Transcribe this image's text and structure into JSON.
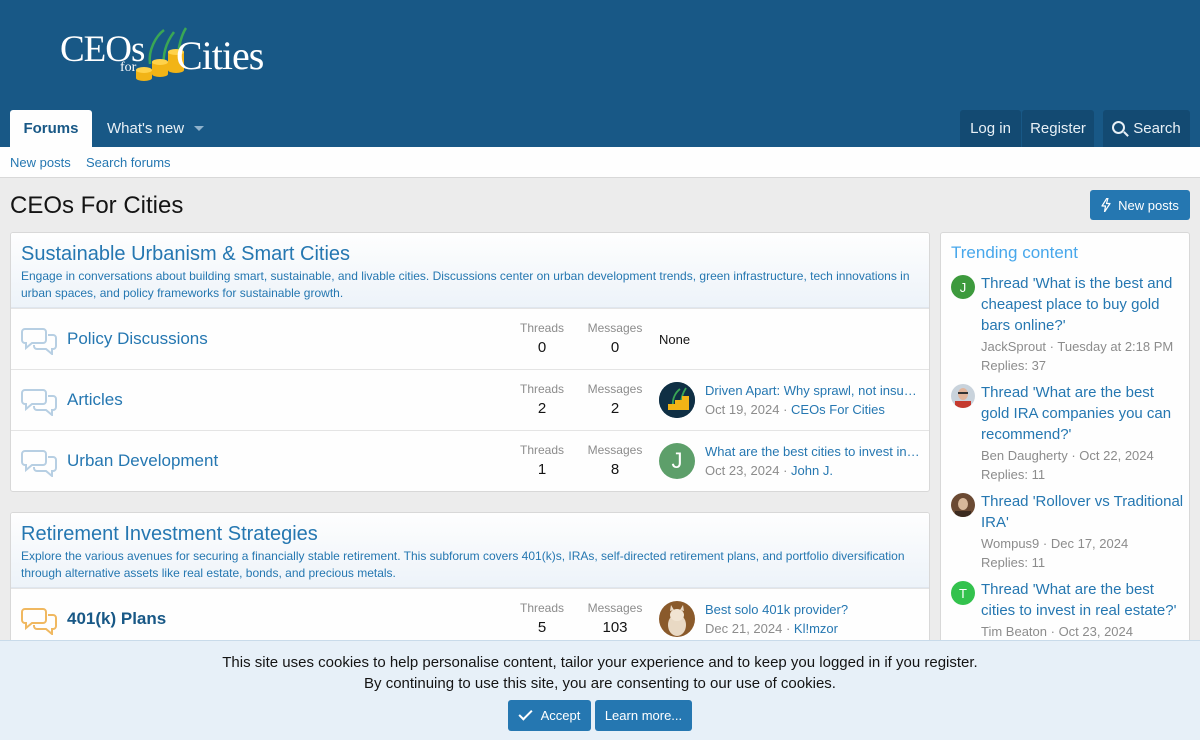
{
  "header": {
    "logo": {
      "line1": "CEOs",
      "line2": "for",
      "line3": "Cities"
    },
    "nav": {
      "forums": "Forums",
      "whats_new": "What's new"
    },
    "account": {
      "login": "Log in",
      "register": "Register",
      "search": "Search"
    }
  },
  "subnav": {
    "new_posts": "New posts",
    "search_forums": "Search forums"
  },
  "page": {
    "title": "CEOs For Cities",
    "new_posts_button": "New posts"
  },
  "categories": [
    {
      "title": "Sustainable Urbanism & Smart Cities",
      "description": "Engage in conversations about building smart, sustainable, and livable cities. Discussions center on urban development trends, green infrastructure, tech innovations in urban spaces, and policy frameworks for sustainable growth.",
      "nodes": [
        {
          "title": "Policy Discussions",
          "threads_label": "Threads",
          "threads": "0",
          "messages_label": "Messages",
          "messages": "0",
          "last_post": "None"
        },
        {
          "title": "Articles",
          "threads_label": "Threads",
          "threads": "2",
          "messages_label": "Messages",
          "messages": "2",
          "last_title": "Driven Apart: Why sprawl, not insufficient roads",
          "last_date": "Oct 19, 2024",
          "last_user": "CEOs For Cities"
        },
        {
          "title": "Urban Development",
          "threads_label": "Threads",
          "threads": "1",
          "messages_label": "Messages",
          "messages": "8",
          "last_title": "What are the best cities to invest in real estate?",
          "last_date": "Oct 23, 2024",
          "last_user": "John J.",
          "avatar_letter": "J"
        }
      ]
    },
    {
      "title": "Retirement Investment Strategies",
      "description": "Explore the various avenues for securing a financially stable retirement. This subforum covers 401(k)s, IRAs, self-directed retirement plans, and portfolio diversification through alternative assets like real estate, bonds, and precious metals.",
      "nodes": [
        {
          "title": "401(k) Plans",
          "threads_label": "Threads",
          "threads": "5",
          "messages_label": "Messages",
          "messages": "103",
          "last_title": "Best solo 401k provider?",
          "last_date": "Dec 21, 2024",
          "last_user": "Kl!mzor"
        }
      ]
    }
  ],
  "sidebar": {
    "title": "Trending content",
    "items": [
      {
        "thread": "Thread 'What is the best and cheapest place to buy gold bars online?'",
        "user": "JackSprout",
        "date": "Tuesday at 2:18 PM",
        "replies": "Replies: 37",
        "avatar_letter": "J",
        "avatar_color": "#3d9a3d"
      },
      {
        "thread": "Thread 'What are the best gold IRA companies you can recommend?'",
        "user": "Ben Daugherty",
        "date": "Oct 22, 2024",
        "replies": "Replies: 11"
      },
      {
        "thread": "Thread 'Rollover vs Traditional IRA'",
        "user": "Wompus9",
        "date": "Dec 17, 2024",
        "replies": "Replies: 11"
      },
      {
        "thread": "Thread 'What are the best cities to invest in real estate?'",
        "user": "Tim Beaton",
        "date": "Oct 23, 2024",
        "avatar_letter": "T",
        "avatar_color": "#33c24d"
      }
    ]
  },
  "cookie": {
    "line1": "This site uses cookies to help personalise content, tailor your experience and to keep you logged in if you register.",
    "line2": "By continuing to use this site, you are consenting to our use of cookies.",
    "accept": "Accept",
    "learn_more": "Learn more..."
  },
  "meta_separator": " · "
}
